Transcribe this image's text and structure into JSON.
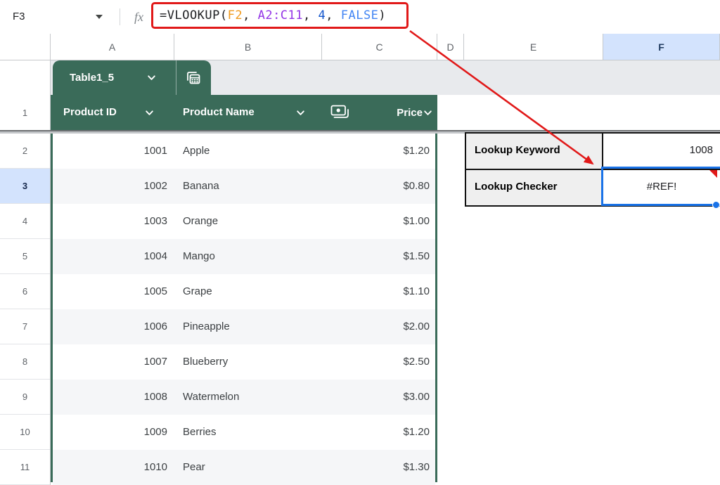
{
  "name_box": {
    "value": "F3"
  },
  "formula_bar": {
    "fx": "fx",
    "parts": [
      {
        "text": "=VLOOKUP(",
        "color": "#202124"
      },
      {
        "text": "F2",
        "color": "#f09a1e"
      },
      {
        "text": ", ",
        "color": "#202124"
      },
      {
        "text": "A2:C11",
        "color": "#9334e6"
      },
      {
        "text": ", ",
        "color": "#202124"
      },
      {
        "text": "4",
        "color": "#1155cc"
      },
      {
        "text": ", ",
        "color": "#202124"
      },
      {
        "text": "FALSE",
        "color": "#4285f4"
      },
      {
        "text": ")",
        "color": "#202124"
      }
    ]
  },
  "columns": {
    "letters": [
      "A",
      "B",
      "C",
      "D",
      "E",
      "F"
    ],
    "selected": "F"
  },
  "rows": {
    "numbers": [
      "1",
      "2",
      "3",
      "4",
      "5",
      "6",
      "7",
      "8",
      "9",
      "10",
      "11"
    ],
    "selected": "3"
  },
  "table_tab": {
    "label": "Table1_5",
    "icons": [
      "chevron-down-icon",
      "table-copy-icon"
    ]
  },
  "product_table": {
    "headers": [
      {
        "label": "Product ID"
      },
      {
        "label": "Product Name"
      },
      {
        "label": "Price"
      }
    ],
    "rows": [
      {
        "id": "1001",
        "name": "Apple",
        "price": "$1.20"
      },
      {
        "id": "1002",
        "name": "Banana",
        "price": "$0.80"
      },
      {
        "id": "1003",
        "name": "Orange",
        "price": "$1.00"
      },
      {
        "id": "1004",
        "name": "Mango",
        "price": "$1.50"
      },
      {
        "id": "1005",
        "name": "Grape",
        "price": "$1.10"
      },
      {
        "id": "1006",
        "name": "Pineapple",
        "price": "$2.00"
      },
      {
        "id": "1007",
        "name": "Blueberry",
        "price": "$2.50"
      },
      {
        "id": "1008",
        "name": "Watermelon",
        "price": "$3.00"
      },
      {
        "id": "1009",
        "name": "Berries",
        "price": "$1.20"
      },
      {
        "id": "1010",
        "name": "Pear",
        "price": "$1.30"
      }
    ]
  },
  "lookup_panel": {
    "rows": [
      {
        "label": "Lookup Keyword",
        "value": "1008"
      },
      {
        "label": "Lookup Checker",
        "value": "#REF!"
      }
    ]
  },
  "colors": {
    "table_green": "#3a6b59",
    "selection_blue": "#1a73e8",
    "header_highlight": "#d3e3fd",
    "annotation_red": "#e11919",
    "band_gray": "#f5f6f8",
    "lookup_label_bg": "#efefef"
  }
}
